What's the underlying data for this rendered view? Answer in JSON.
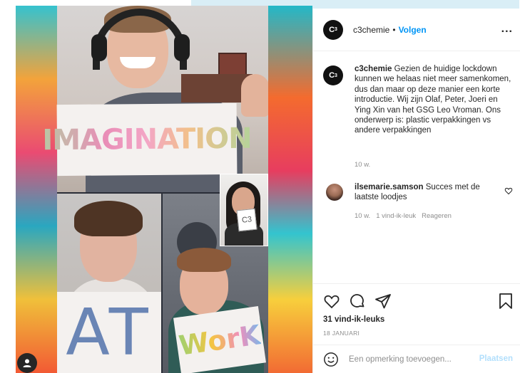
{
  "post": {
    "header": {
      "avatar_text": "C",
      "avatar_sup": "3",
      "username": "c3chemie",
      "separator": "•",
      "follow_label": "Volgen",
      "more_label": "..."
    },
    "caption": {
      "username": "c3chemie",
      "text": "Gezien de huidige lockdown kunnen we helaas niet meer samenkomen, dus dan maar op deze manier een korte introductie. Wij zijn Olaf, Peter, Joeri en Ying Xin van het GSG Leo Vroman. Ons onderwerp is: plastic verpakkingen vs andere verpakkingen",
      "time": "10 w."
    },
    "comments": [
      {
        "username": "ilsemarie.samson",
        "text": "Succes met de laatste loodjes",
        "time": "10 w.",
        "likes": "1 vind-ik-leuk",
        "reply_label": "Reageren"
      }
    ],
    "likes_count": "31 vind-ik-leuks",
    "date": "18 JANUARI",
    "comment_box": {
      "placeholder": "Een opmerking toevoegen...",
      "post_label": "Plaatsen"
    }
  },
  "media": {
    "signs": {
      "top": "IMAGINATION",
      "bottom_left": "AT",
      "bottom_right": "WorK",
      "small": "C3"
    }
  },
  "icons": [
    "heart-icon",
    "comment-icon",
    "share-icon",
    "bookmark-icon",
    "emoji-icon",
    "user-icon",
    "more-icon"
  ],
  "colors": {
    "follow": "#0095f6",
    "post_button_disabled": "#b2dffc",
    "muted_text": "#8e8e8e"
  }
}
